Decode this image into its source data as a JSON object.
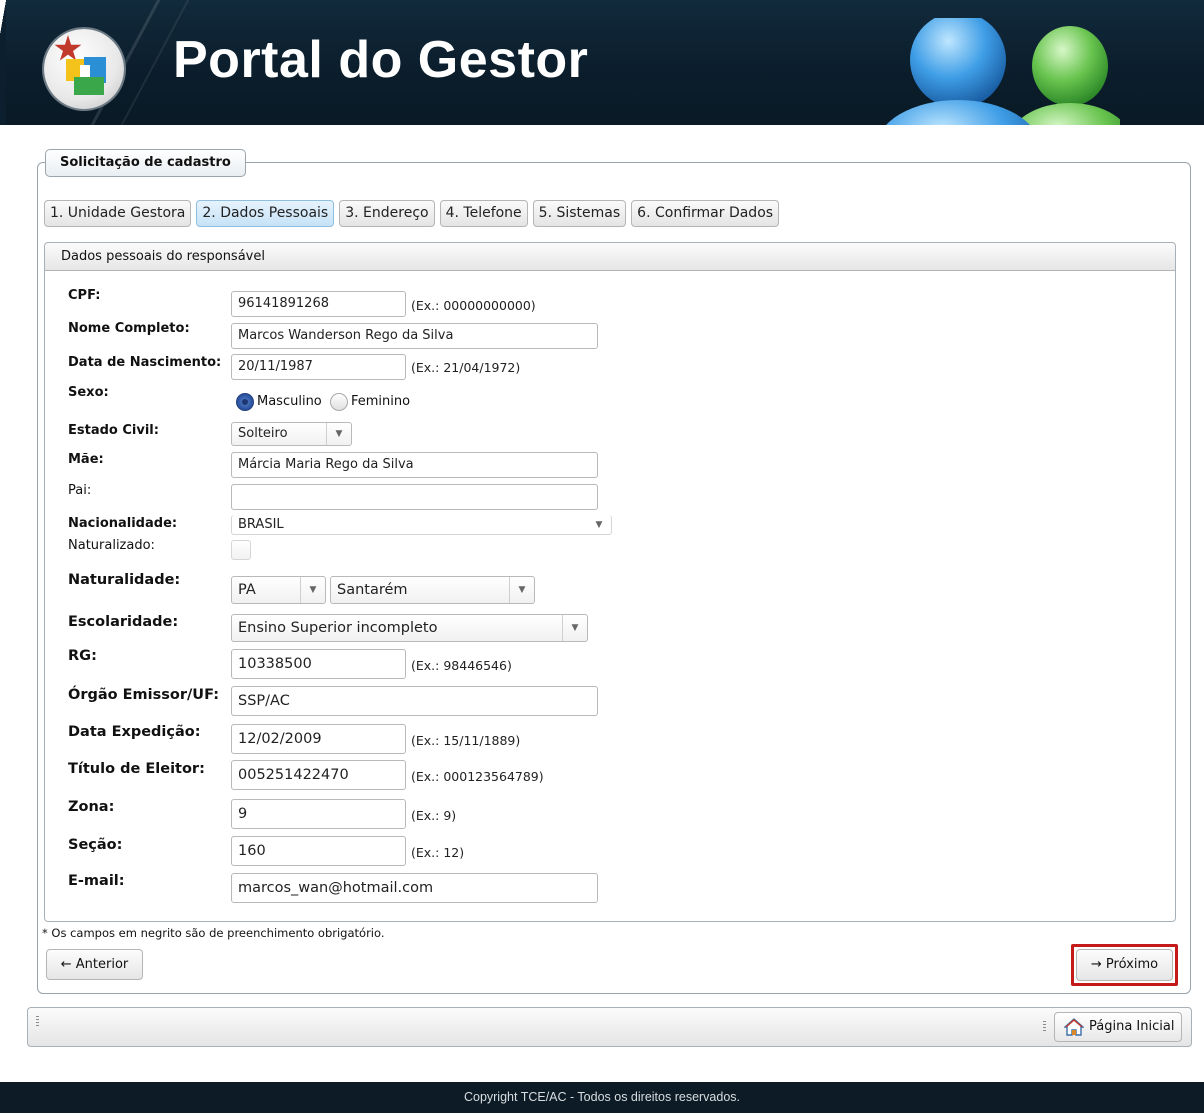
{
  "header": {
    "title": "Portal do Gestor"
  },
  "form": {
    "legend": "Solicitação de cadastro",
    "tabs": [
      {
        "label": "1. Unidade Gestora"
      },
      {
        "label": "2. Dados Pessoais",
        "active": true
      },
      {
        "label": "3. Endereço"
      },
      {
        "label": "4. Telefone"
      },
      {
        "label": "5. Sistemas"
      },
      {
        "label": "6. Confirmar Dados"
      }
    ],
    "panel_title": "Dados pessoais do responsável",
    "fields": {
      "cpf": {
        "label": "CPF:",
        "value": "96141891268",
        "example": "(Ex.: 00000000000)"
      },
      "nome": {
        "label": "Nome Completo:",
        "value": "Marcos Wanderson Rego da Silva"
      },
      "nascimento": {
        "label": "Data de Nascimento:",
        "value": "20/11/1987",
        "example": "(Ex.: 21/04/1972)"
      },
      "sexo": {
        "label": "Sexo:",
        "options": [
          "Masculino",
          "Feminino"
        ],
        "selected": "Masculino"
      },
      "estado_civil": {
        "label": "Estado Civil:",
        "value": "Solteiro"
      },
      "mae": {
        "label": "Mãe:",
        "value": "Márcia Maria Rego da Silva"
      },
      "pai": {
        "label": "Pai:",
        "value": ""
      },
      "nacionalidade": {
        "label": "Nacionalidade:",
        "value": "BRASIL"
      },
      "naturalizado": {
        "label": "Naturalizado:",
        "checked": false
      },
      "naturalidade": {
        "label": "Naturalidade:",
        "uf": "PA",
        "cidade": "Santarém"
      },
      "escolaridade": {
        "label": "Escolaridade:",
        "value": "Ensino Superior incompleto"
      },
      "rg": {
        "label": "RG:",
        "value": "10338500",
        "example": "(Ex.: 98446546)"
      },
      "orgao": {
        "label": "Órgão Emissor/UF:",
        "value": "SSP/AC"
      },
      "expedicao": {
        "label": "Data Expedição:",
        "value": "12/02/2009",
        "example": "(Ex.: 15/11/1889)"
      },
      "titulo": {
        "label": "Título de Eleitor:",
        "value": "005251422470",
        "example": "(Ex.: 000123564789)"
      },
      "zona": {
        "label": "Zona:",
        "value": "9",
        "example": "(Ex.: 9)"
      },
      "secao": {
        "label": "Seção:",
        "value": "160",
        "example": "(Ex.: 12)"
      },
      "email": {
        "label": "E-mail:",
        "value": "marcos_wan@hotmail.com"
      }
    },
    "footnote": "* Os campos em negrito são de preenchimento obrigatório.",
    "prev_label": "← Anterior",
    "next_label": "→ Próximo"
  },
  "toolbar": {
    "home_label": "Página Inicial"
  },
  "footer": {
    "copyright": "Copyright TCE/AC - Todos os direitos reservados."
  },
  "colors": {
    "header_bg": "#0d2233",
    "highlight": "#c41a1a",
    "active_tab": "#c6e2f7",
    "radio_selected": "#2d55a4"
  }
}
